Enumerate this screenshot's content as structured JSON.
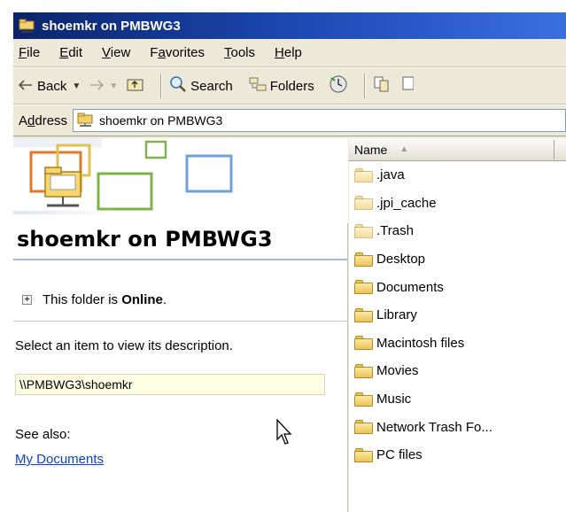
{
  "window": {
    "title": "shoemkr on PMBWG3"
  },
  "menu": {
    "items": [
      {
        "pre": "",
        "u": "F",
        "post": "ile"
      },
      {
        "pre": "",
        "u": "E",
        "post": "dit"
      },
      {
        "pre": "",
        "u": "V",
        "post": "iew"
      },
      {
        "pre": "F",
        "u": "a",
        "post": "vorites"
      },
      {
        "pre": "",
        "u": "T",
        "post": "ools"
      },
      {
        "pre": "",
        "u": "H",
        "post": "elp"
      }
    ]
  },
  "toolbar": {
    "back_label": "Back",
    "search_label": "Search",
    "folders_label": "Folders"
  },
  "address": {
    "label_pre": "A",
    "label_u": "d",
    "label_post": "dress",
    "value": "shoemkr on PMBWG3"
  },
  "taskpane": {
    "title": "shoemkr on PMBWG3",
    "status_prefix": "This folder is ",
    "status_value": "Online",
    "status_suffix": ".",
    "description": "Select an item to view its description.",
    "path": "\\\\PMBWG3\\shoemkr",
    "see_also": "See also:",
    "link_my_documents": "My Documents"
  },
  "filelist": {
    "column_name": "Name",
    "sort_icon": "sort-ascending-icon",
    "items": [
      {
        "name": ".java",
        "hidden": true
      },
      {
        "name": ".jpi_cache",
        "hidden": true
      },
      {
        "name": ".Trash",
        "hidden": true
      },
      {
        "name": "Desktop",
        "hidden": false
      },
      {
        "name": "Documents",
        "hidden": false
      },
      {
        "name": "Library",
        "hidden": false
      },
      {
        "name": "Macintosh files",
        "hidden": false
      },
      {
        "name": "Movies",
        "hidden": false
      },
      {
        "name": "Music",
        "hidden": false
      },
      {
        "name": "Network Trash Fo...",
        "hidden": false
      },
      {
        "name": "PC files",
        "hidden": false
      }
    ]
  },
  "colors": {
    "titlebar": "#0a246a",
    "link": "#0b42cf",
    "folder": "#e9c35a"
  }
}
